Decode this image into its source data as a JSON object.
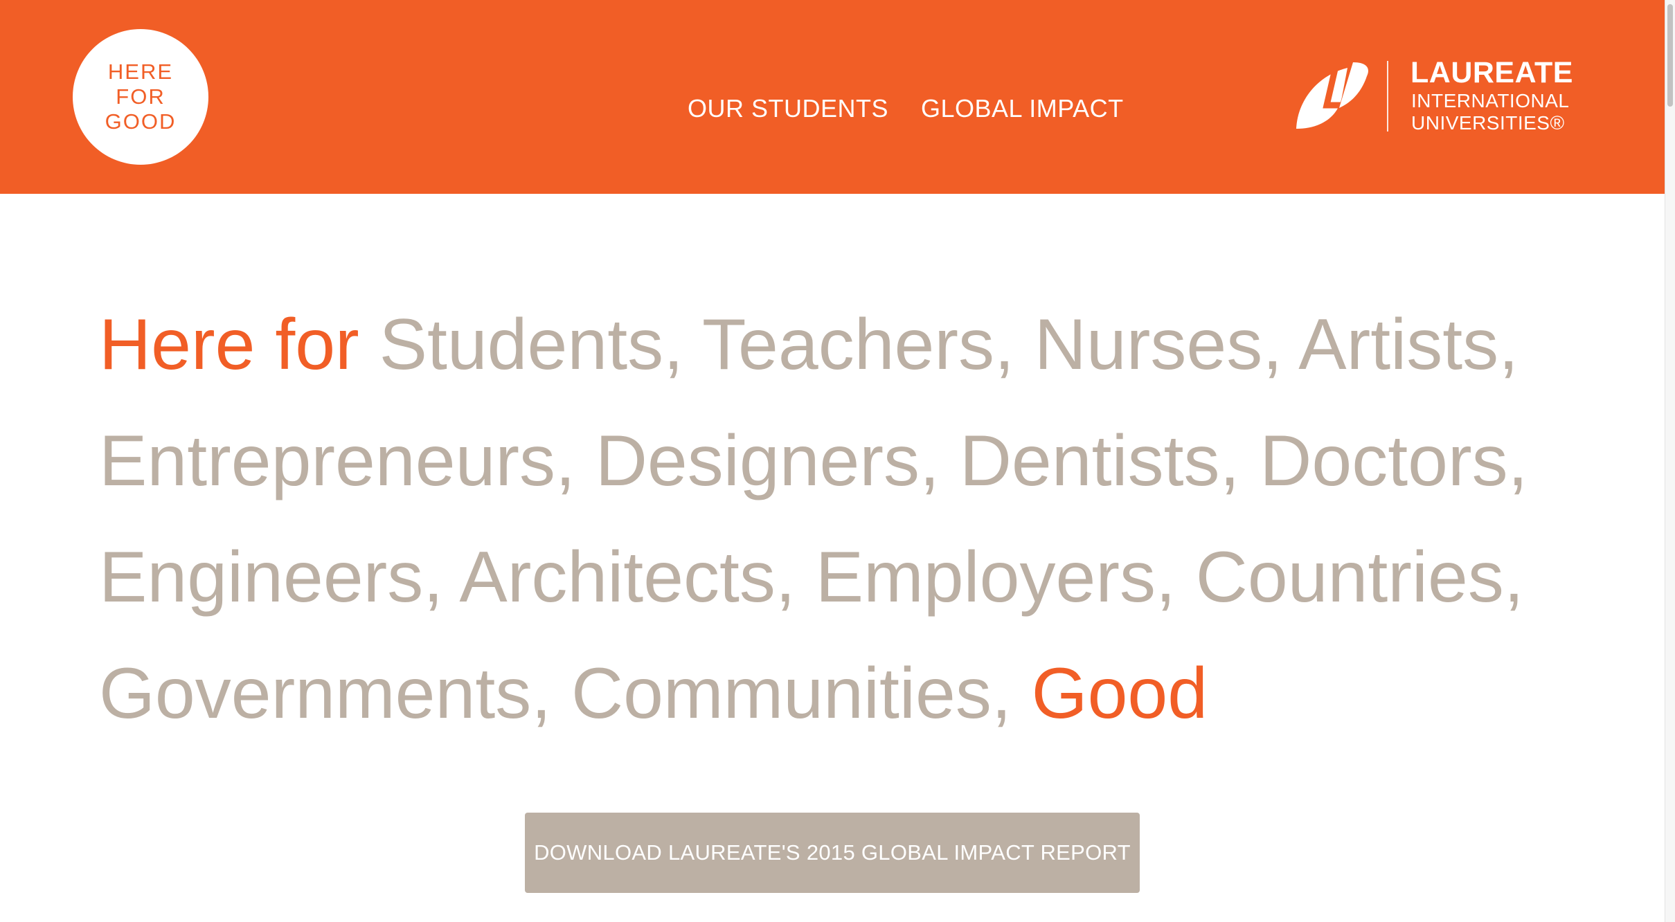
{
  "header": {
    "background_color": "#f15e26",
    "badge": {
      "lines": [
        "HERE",
        "FOR",
        "GOOD"
      ]
    },
    "nav": [
      {
        "label": "OUR STUDENTS"
      },
      {
        "label": "GLOBAL IMPACT"
      }
    ],
    "logo": {
      "brand": "LAUREATE",
      "subtitle_1": "INTERNATIONAL",
      "subtitle_2": "UNIVERSITIES®",
      "icon": "leaf-l-logo-icon"
    }
  },
  "hero": {
    "accent_color": "#f15e26",
    "text_color": "#bcb0a4",
    "line_1": {
      "accent": "Here for",
      "text": " Students, Teachers, Nurses, Artists,"
    },
    "line_2": "Entrepreneurs, Designers, Dentists, Doctors,",
    "line_3": "Engineers, Architects, Employers, Countries,",
    "line_4": {
      "text": "Governments, Communities, ",
      "accent": "Good"
    }
  },
  "cta": {
    "label": "DOWNLOAD LAUREATE'S 2015 GLOBAL IMPACT REPORT",
    "background_color": "#bcb0a4"
  }
}
